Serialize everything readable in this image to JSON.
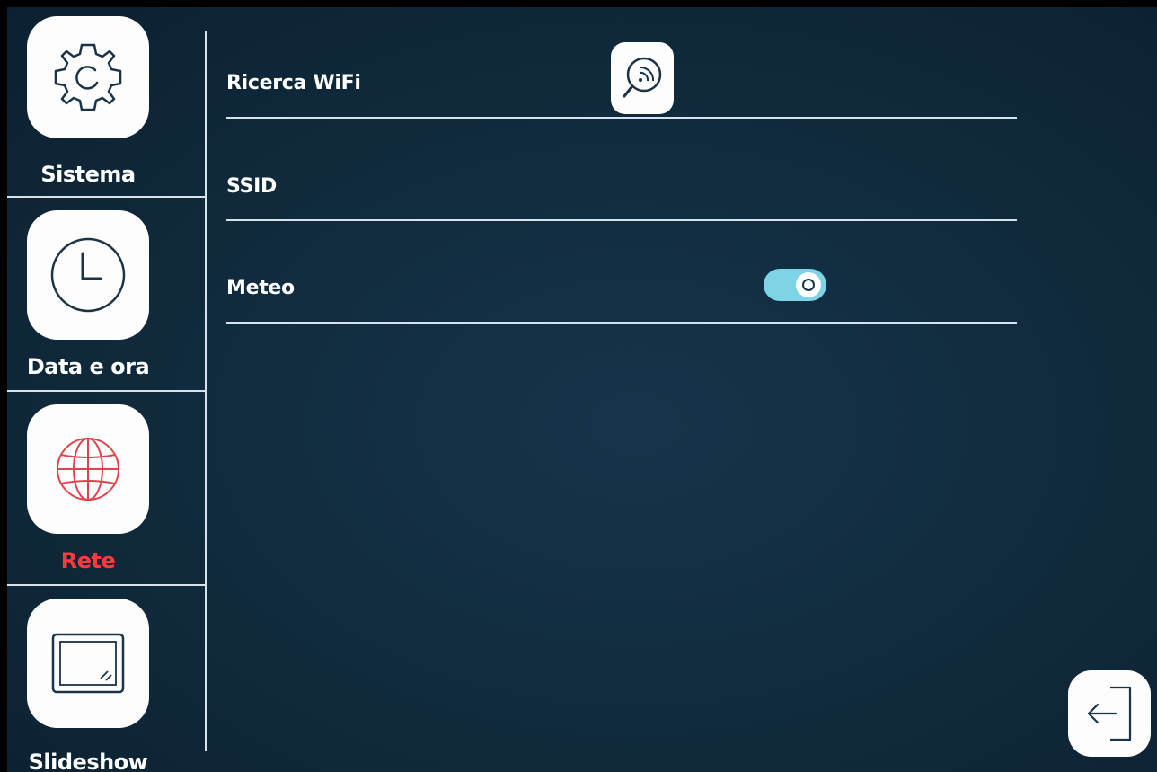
{
  "sidebar": {
    "items": [
      {
        "label": "Sistema",
        "icon": "gear-icon"
      },
      {
        "label": "Data e ora",
        "icon": "clock-icon"
      },
      {
        "label": "Rete",
        "icon": "globe-icon",
        "active": true
      },
      {
        "label": "Slideshow",
        "icon": "picture-frame-icon"
      }
    ]
  },
  "main": {
    "rows": [
      {
        "label": "Ricerca WiFi",
        "control": "wifi-search-button"
      },
      {
        "label": "SSID"
      },
      {
        "label": "Meteo",
        "control": "toggle",
        "toggle_on": true
      }
    ]
  },
  "footer": {
    "exit_icon": "exit-icon"
  },
  "colors": {
    "background": "#102a3c",
    "active_label": "#ff3b3b",
    "tile": "#fdfdfd",
    "toggle": "#7fd3e6",
    "globe": "#e0434d"
  }
}
